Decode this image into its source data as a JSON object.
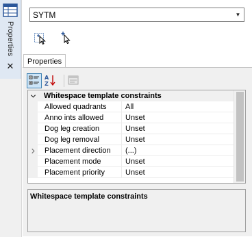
{
  "dock": {
    "label": "Properties",
    "icons": {
      "grid": "properties-grid-icon",
      "close": "close-icon"
    }
  },
  "selector": {
    "value": "SYTM"
  },
  "tools": [
    {
      "name": "add-placement-tool",
      "icon": "add-cursor-icon"
    },
    {
      "name": "select-placement-tool",
      "icon": "pointer-select-icon"
    }
  ],
  "tabs": [
    {
      "label": "Properties",
      "active": true
    }
  ],
  "property_toolbar": {
    "buttons": [
      "categorized-icon",
      "alphabetical-sort-icon",
      "property-pages-icon"
    ],
    "active": "categorized-icon"
  },
  "grid": {
    "category": "Whitespace template constraints",
    "properties": [
      {
        "name": "Allowed quadrants",
        "value": "All",
        "expandable": false
      },
      {
        "name": "Anno ints allowed",
        "value": "Unset",
        "expandable": false
      },
      {
        "name": "Dog leg creation",
        "value": "Unset",
        "expandable": false
      },
      {
        "name": "Dog leg removal",
        "value": "Unset",
        "expandable": false
      },
      {
        "name": "Placement direction",
        "value": "(...)",
        "expandable": true
      },
      {
        "name": "Placement mode",
        "value": "Unset",
        "expandable": false
      },
      {
        "name": "Placement priority",
        "value": "Unset",
        "expandable": false
      }
    ]
  },
  "description": {
    "title": "Whitespace template constraints"
  },
  "colors": {
    "dock_tab": "#dfe8f3",
    "active_button": "#cce4f7",
    "active_border": "#3c7fb1",
    "scroll_thumb": "#c2c2c2"
  }
}
